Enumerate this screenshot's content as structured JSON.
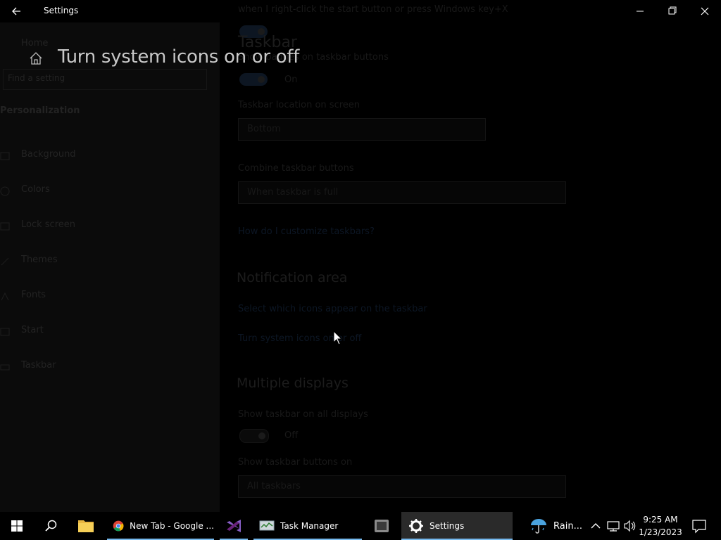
{
  "window": {
    "title": "Settings"
  },
  "dialog": {
    "title": "Turn system icons on or off"
  },
  "sidebar": {
    "home_label": "Home",
    "search_placeholder": "Find a setting",
    "section": "Personalization",
    "items": [
      {
        "label": "Background",
        "icon": "picture-icon"
      },
      {
        "label": "Colors",
        "icon": "palette-icon"
      },
      {
        "label": "Lock screen",
        "icon": "lock-screen-icon"
      },
      {
        "label": "Themes",
        "icon": "brush-icon"
      },
      {
        "label": "Fonts",
        "icon": "font-icon"
      },
      {
        "label": "Start",
        "icon": "start-icon"
      },
      {
        "label": "Taskbar",
        "icon": "taskbar-icon"
      }
    ]
  },
  "main": {
    "top_text": "when I right-click the start button or press Windows key+X",
    "taskbar_heading": "Taskbar",
    "toggle_label": "On",
    "badges_label": "Show badges on taskbar buttons",
    "location_label": "Taskbar location on screen",
    "location_value": "Bottom",
    "combine_label": "Combine taskbar buttons",
    "combine_value": "When taskbar is full",
    "customize_link": "How do I customize taskbars?",
    "notification_heading": "Notification area",
    "select_icons_link": "Select which icons appear on the taskbar",
    "system_icons_link": "Turn system icons on or off",
    "multiple_heading": "Multiple displays",
    "show_all_label": "Show taskbar on all displays",
    "off_label": "Off",
    "show_buttons_label": "Show taskbar buttons on",
    "show_buttons_value": "All taskbars"
  },
  "taskbar": {
    "chrome_label": "New Tab - Google ...",
    "task_manager_label": "Task Manager",
    "settings_label": "Settings",
    "weather_label": "Rain...",
    "time": "9:25 AM",
    "date": "1/23/2023"
  },
  "colors": {
    "accent": "#76b9ed",
    "active_task_bg": "#2a2a2a"
  }
}
